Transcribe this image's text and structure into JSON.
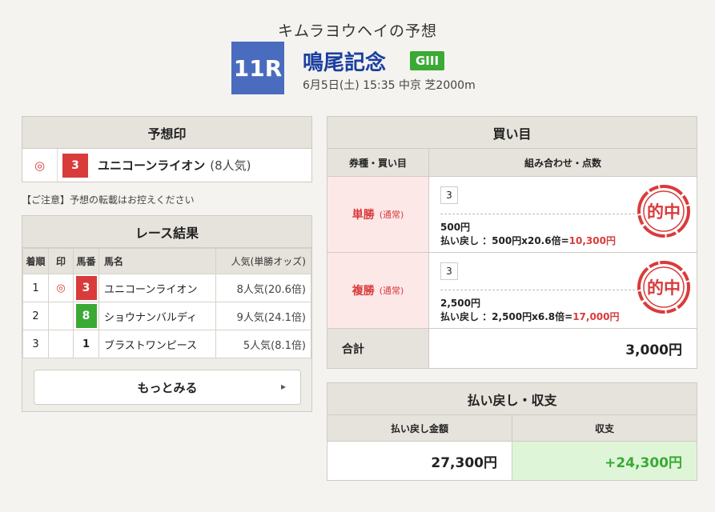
{
  "header": {
    "title": "キムラヨウヘイの予想",
    "race_number": "11R",
    "race_name": "鳴尾記念",
    "grade": "GIII",
    "race_info": "6月5日(土) 15:35 中京 芝2000m"
  },
  "yoso": {
    "title": "予想印",
    "mark": "◎",
    "horse_number": "3",
    "horse_name": "ユニコーンライオン",
    "popularity": "(8人気)"
  },
  "notice": "【ご注意】予想の転載はお控えください",
  "result": {
    "title": "レース結果",
    "columns": [
      "着順",
      "印",
      "馬番",
      "馬名",
      "人気(単勝オッズ)"
    ],
    "rows": [
      {
        "rank": "1",
        "mark": "◎",
        "number": "3",
        "name": "ユニコーンライオン",
        "pop": "8人気(20.6倍)"
      },
      {
        "rank": "2",
        "mark": "",
        "number": "8",
        "name": "ショウナンバルディ",
        "pop": "9人気(24.1倍)"
      },
      {
        "rank": "3",
        "mark": "",
        "number": "1",
        "name": "ブラストワンピース",
        "pop": "5人気(8.1倍)"
      }
    ],
    "more_label": "もっとみる"
  },
  "kaime": {
    "title": "買い目",
    "col_type": "券種・買い目",
    "col_combo": "組み合わせ・点数",
    "bets": [
      {
        "type": "単勝",
        "sub": "(通常)",
        "combo": "3",
        "amount": "500円",
        "payout_label": "払い戻し ：500円x20.6倍=",
        "payout": "10,300円",
        "stamp": "的中"
      },
      {
        "type": "複勝",
        "sub": "(通常)",
        "combo": "3",
        "amount": "2,500円",
        "payout_label": "払い戻し ：2,500円x6.8倍=",
        "payout": "17,000円",
        "stamp": "的中"
      }
    ],
    "total_label": "合計",
    "total_value": "3,000円"
  },
  "shushi": {
    "title": "払い戻し・収支",
    "col_payout": "払い戻し金額",
    "col_balance": "収支",
    "payout": "27,300円",
    "balance": "+24,300円"
  },
  "colors": {
    "accent_blue": "#4a6cbf",
    "race_name": "#1a3fa0",
    "grade_green": "#3aaa35",
    "hit_red": "#d93b3b",
    "plus_green": "#3aaa35"
  }
}
